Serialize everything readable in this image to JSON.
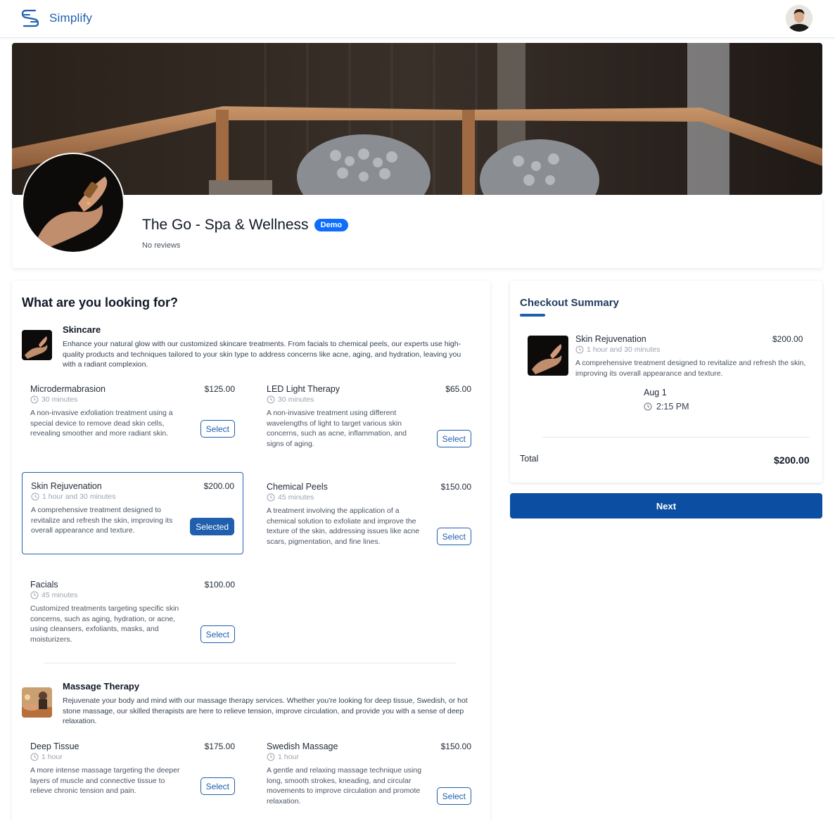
{
  "nav": {
    "brand": "Simplify"
  },
  "business": {
    "name": "The Go - Spa & Wellness",
    "badge": "Demo",
    "reviews": "No reviews"
  },
  "section_title": "What are you looking for?",
  "categories": [
    {
      "name": "Skincare",
      "description": "Enhance your natural glow with our customized skincare treatments. From facials to chemical peels, our experts use high-quality products and techniques tailored to your skin type to address concerns like acne, aging, and hydration, leaving you with a radiant complexion.",
      "services": [
        {
          "name": "Microdermabrasion",
          "price": "$125.00",
          "duration": "30 minutes",
          "description": "A non-invasive exfoliation treatment using a special device to remove dead skin cells, revealing smoother and more radiant skin.",
          "button": "Select"
        },
        {
          "name": "LED Light Therapy",
          "price": "$65.00",
          "duration": "30 minutes",
          "description": "A non-invasive treatment using different wavelengths of light to target various skin concerns, such as acne, inflammation, and signs of aging.",
          "button": "Select"
        },
        {
          "name": "Skin Rejuvenation",
          "price": "$200.00",
          "duration": "1 hour and 30 minutes",
          "description": "A comprehensive treatment designed to revitalize and refresh the skin, improving its overall appearance and texture.",
          "button": "Selected"
        },
        {
          "name": "Chemical Peels",
          "price": "$150.00",
          "duration": "45 minutes",
          "description": "A treatment involving the application of a chemical solution to exfoliate and improve the texture of the skin, addressing issues like acne scars, pigmentation, and fine lines.",
          "button": "Select"
        },
        {
          "name": "Facials",
          "price": "$100.00",
          "duration": "45 minutes",
          "description": "Customized treatments targeting specific skin concerns, such as aging, hydration, or acne, using cleansers, exfoliants, masks, and moisturizers.",
          "button": "Select"
        }
      ]
    },
    {
      "name": "Massage Therapy",
      "description": "Rejuvenate your body and mind with our massage therapy services. Whether you're looking for deep tissue, Swedish, or hot stone massage, our skilled therapists are here to relieve tension, improve circulation, and provide you with a sense of deep relaxation.",
      "services": [
        {
          "name": "Deep Tissue",
          "price": "$175.00",
          "duration": "1 hour",
          "description": "A more intense massage targeting the deeper layers of muscle and connective tissue to relieve chronic tension and pain.",
          "button": "Select"
        },
        {
          "name": "Swedish Massage",
          "price": "$150.00",
          "duration": "1 hour",
          "description": "A gentle and relaxing massage technique using long, smooth strokes, kneading, and circular movements to improve circulation and promote relaxation.",
          "button": "Select"
        }
      ]
    }
  ],
  "checkout": {
    "title": "Checkout Summary",
    "item": {
      "name": "Skin Rejuvenation",
      "price": "$200.00",
      "duration": "1 hour and 30 minutes",
      "description": "A comprehensive treatment designed to revitalize and refresh the skin, improving its overall appearance and texture."
    },
    "date": "Aug 1",
    "time": "2:15 PM",
    "total_label": "Total",
    "total_value": "$200.00",
    "next_label": "Next"
  },
  "colors": {
    "primary": "#1f5fad",
    "next_button": "#0b4ea2",
    "demo_badge": "#0d6efd"
  }
}
